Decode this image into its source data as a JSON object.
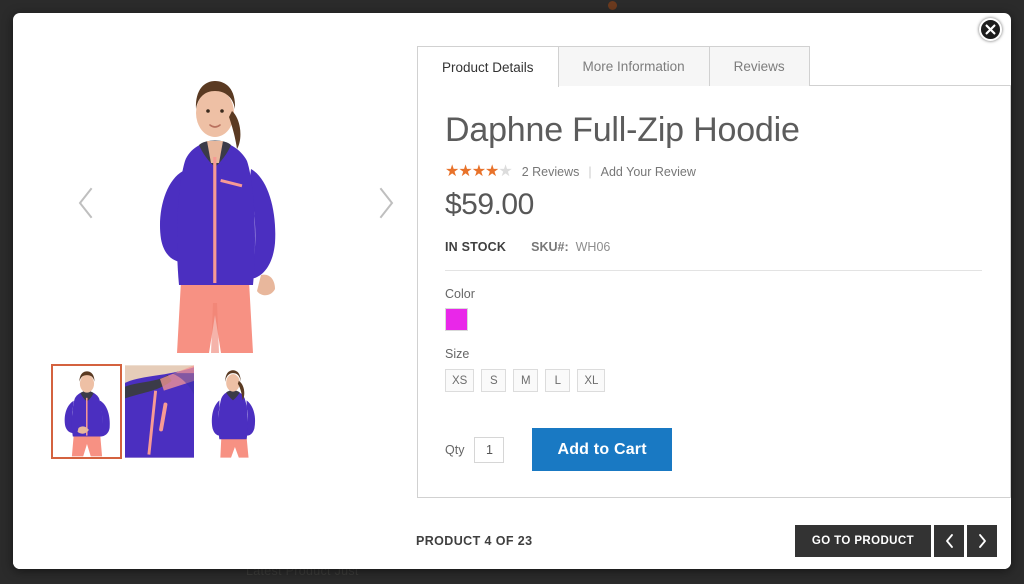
{
  "overlay": {
    "background_top_text": "",
    "background_bottom_text": "Latest Product Just"
  },
  "modal": {
    "close_label": "✕"
  },
  "gallery": {
    "prev_label": "Previous image",
    "next_label": "Next image",
    "thumbnails": [
      {
        "name": "thumb-front-full",
        "selected": true
      },
      {
        "name": "thumb-zip-detail",
        "selected": false
      },
      {
        "name": "thumb-back-view",
        "selected": false
      }
    ]
  },
  "tabs": [
    {
      "label": "Product Details",
      "active": true
    },
    {
      "label": "More Information",
      "active": false
    },
    {
      "label": "Reviews",
      "active": false
    }
  ],
  "product": {
    "title": "Daphne Full-Zip Hoodie",
    "rating_stars": 4,
    "rating_total": 5,
    "reviews_label": "2 Reviews",
    "separator": "|",
    "add_review_label": "Add Your Review",
    "price": "$59.00",
    "stock_status": "IN STOCK",
    "sku_label": "SKU#:",
    "sku_value": "WH06",
    "color_label": "Color",
    "colors": [
      {
        "name": "magenta",
        "hex": "#e927e9",
        "selected": true
      }
    ],
    "size_label": "Size",
    "sizes": [
      "XS",
      "S",
      "M",
      "L",
      "XL"
    ],
    "qty_label": "Qty",
    "qty_value": "1",
    "add_to_cart_label": "Add to Cart"
  },
  "footer": {
    "counter_text": "PRODUCT 4 OF 23",
    "goto_product_label": "GO TO PRODUCT",
    "prev_label": "‹",
    "next_label": "›"
  },
  "colors": {
    "accent_blue": "#1979c3",
    "star_orange": "#e8722a",
    "dark_button": "#333333",
    "overlay": "#2b2b2b"
  }
}
